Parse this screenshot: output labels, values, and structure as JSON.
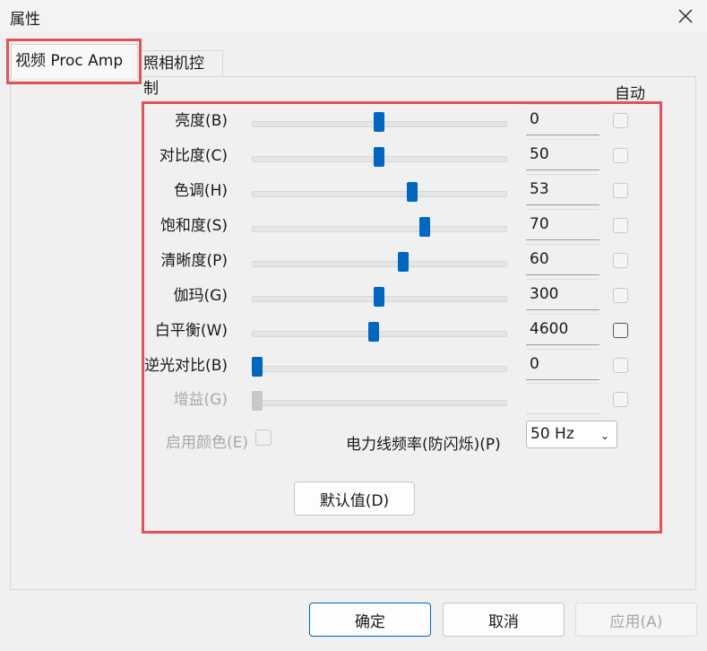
{
  "window": {
    "title": "属性"
  },
  "tabs": [
    {
      "label": "视频 Proc Amp"
    },
    {
      "label": "照相机控制"
    }
  ],
  "auto_header": "自动",
  "controls": [
    {
      "label": "亮度(B)",
      "value": "0",
      "slider_fraction": 0.5,
      "auto": false,
      "enabled": true
    },
    {
      "label": "对比度(C)",
      "value": "50",
      "slider_fraction": 0.5,
      "auto": false,
      "enabled": true
    },
    {
      "label": "色调(H)",
      "value": "53",
      "slider_fraction": 0.64,
      "auto": false,
      "enabled": true
    },
    {
      "label": "饱和度(S)",
      "value": "70",
      "slider_fraction": 0.69,
      "auto": false,
      "enabled": true
    },
    {
      "label": "清晰度(P)",
      "value": "60",
      "slider_fraction": 0.6,
      "auto": false,
      "enabled": true
    },
    {
      "label": "伽玛(G)",
      "value": "300",
      "slider_fraction": 0.5,
      "auto": false,
      "enabled": true
    },
    {
      "label": "白平衡(W)",
      "value": "4600",
      "slider_fraction": 0.48,
      "auto": false,
      "enabled": true
    },
    {
      "label": "逆光对比(B)",
      "value": "0",
      "slider_fraction": 0.0,
      "auto": false,
      "enabled": true
    },
    {
      "label": "增益(G)",
      "value": "",
      "slider_fraction": 0.0,
      "auto": false,
      "enabled": false
    }
  ],
  "enable_color": {
    "label": "启用颜色(E)",
    "checked": false
  },
  "power_line": {
    "label": "电力线频率(防闪烁)(P)",
    "selected": "50 Hz"
  },
  "buttons": {
    "default": "默认值(D)",
    "ok": "确定",
    "cancel": "取消",
    "apply": "应用(A)"
  },
  "colors": {
    "accent": "#0067c0",
    "highlight": "#e0525a"
  }
}
